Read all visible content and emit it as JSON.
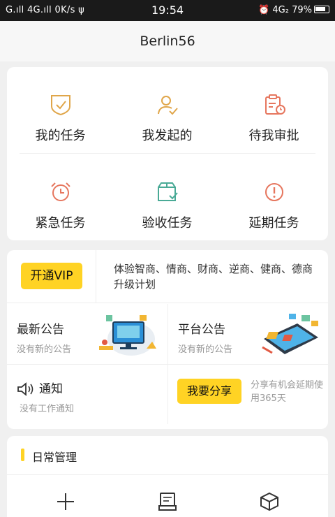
{
  "status_bar": {
    "left": "G.ıll 4G.ıll 0K/s ψ",
    "time": "19:54",
    "right": "⏰ 4G₂ 79%"
  },
  "header": {
    "title": "Berlin56"
  },
  "tasks": [
    {
      "label": "我的任务",
      "icon": "shield-check-icon",
      "color": "#e0a64a"
    },
    {
      "label": "我发起的",
      "icon": "user-check-icon",
      "color": "#e0a64a"
    },
    {
      "label": "待我审批",
      "icon": "clipboard-clock-icon",
      "color": "#e6765e"
    },
    {
      "label": "紧急任务",
      "icon": "alarm-clock-icon",
      "color": "#e6765e"
    },
    {
      "label": "验收任务",
      "icon": "box-check-icon",
      "color": "#4aaa96"
    },
    {
      "label": "延期任务",
      "icon": "exclamation-circle-icon",
      "color": "#e6765e"
    }
  ],
  "vip": {
    "button": "开通VIP",
    "text": "体验智商、情商、财商、逆商、健商、德商升级计划"
  },
  "notices": {
    "latest": {
      "title": "最新公告",
      "sub": "没有新的公告"
    },
    "platform": {
      "title": "平台公告",
      "sub": "没有新的公告"
    },
    "notify": {
      "title": "通知",
      "sub": "没有工作通知"
    },
    "share": {
      "button": "我要分享",
      "text": "分享有机会延期使用365天"
    }
  },
  "daily": {
    "title": "日常管理",
    "icons": [
      "plus-icon",
      "document-icon",
      "cube-icon"
    ]
  },
  "colors": {
    "accent": "#ffd324",
    "muted": "#999999"
  }
}
